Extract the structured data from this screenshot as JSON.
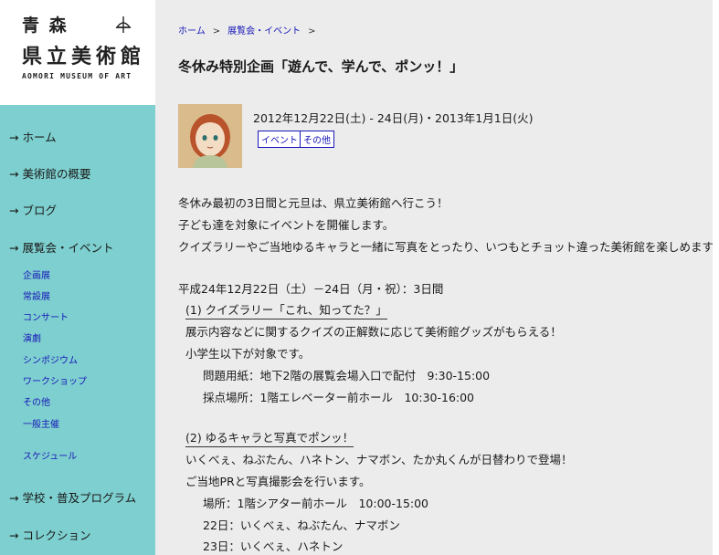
{
  "logo": {
    "jp_line1": "青  森",
    "jp_line2": "県立美術館",
    "en": "AOMORI MUSEUM OF ART"
  },
  "nav": {
    "arrow": "→",
    "items": [
      {
        "label": "ホーム"
      },
      {
        "label": "美術館の概要"
      },
      {
        "label": "ブログ"
      },
      {
        "label": "展覧会・イベント"
      },
      {
        "label": "学校・普及プログラム"
      },
      {
        "label": "コレクション"
      }
    ],
    "sub_items": [
      {
        "label": "企画展"
      },
      {
        "label": "常設展"
      },
      {
        "label": "コンサート"
      },
      {
        "label": "演劇"
      },
      {
        "label": "シンポジウム"
      },
      {
        "label": "ワークショップ"
      },
      {
        "label": "その他"
      },
      {
        "label": "一般主催"
      },
      {
        "label": "スケジュール"
      }
    ]
  },
  "breadcrumb": {
    "home": "ホーム",
    "sep": ">",
    "section": "展覧会・イベント",
    "sep2": ">"
  },
  "article": {
    "title": "冬休み特別企画「遊んで、学んで、ポンッ！」",
    "date": "2012年12月22日(土) - 24日(月)・2013年1月1日(火)",
    "tags": [
      "イベント",
      "その他"
    ],
    "intro": [
      "冬休み最初の3日間と元旦は、県立美術館へ行こう！",
      "子ども達を対象にイベントを開催します。",
      "クイズラリーやご当地ゆるキャラと一緒に写真をとったり、いつもとチョット違った美術館を楽しめます。"
    ],
    "period": "平成24年12月22日（土）－24日（月・祝）：3日間",
    "section1": {
      "heading": "(1) クイズラリー「これ、知ってた？」",
      "lines": [
        "展示内容などに関するクイズの正解数に応じて美術館グッズがもらえる！",
        "小学生以下が対象です。",
        "問題用紙：地下2階の展覧会場入口で配付　9:30-15:00",
        "採点場所：1階エレベーター前ホール　10:30-16:00"
      ]
    },
    "section2": {
      "heading": "(2) ゆるキャラと写真でポンッ！",
      "lines": [
        "いくべぇ、ねぶたん、ハネトン、ナマボン、たか丸くんが日替わりで登場！",
        "ご当地PRと写真撮影会を行います。",
        "場所：1階シアター前ホール　10:00-15:00",
        "22日：いくべぇ、ねぶたん、ナマボン",
        "23日：いくべぇ、ハネトン"
      ]
    }
  },
  "colors": {
    "sidebar_bg": "#7ecfcf",
    "main_bg": "#ececec",
    "link": "#1616b8"
  }
}
